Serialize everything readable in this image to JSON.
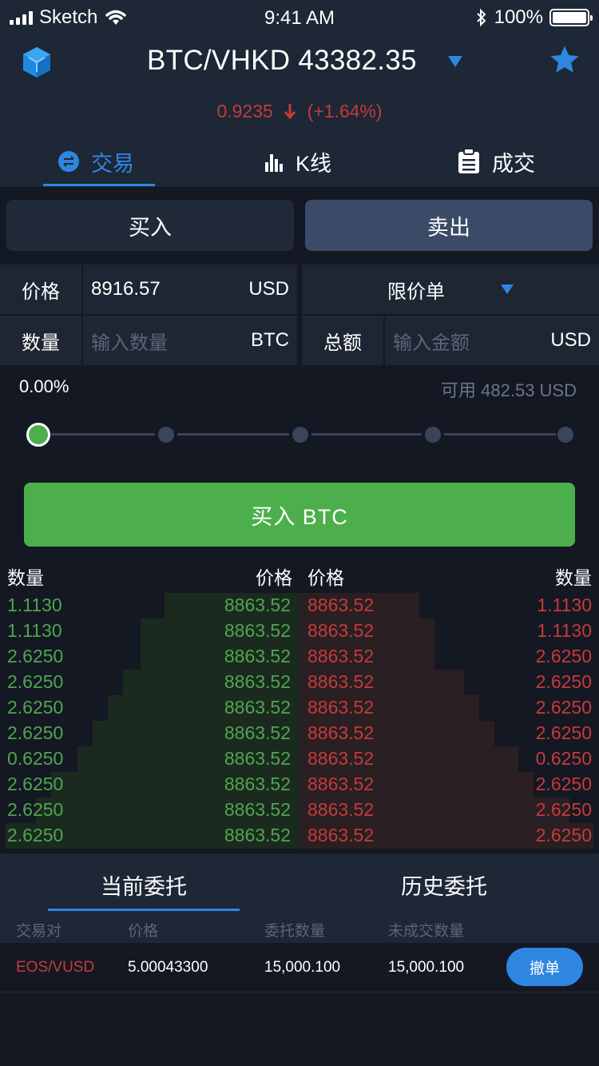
{
  "status": {
    "carrier": "Sketch",
    "time": "9:41 AM",
    "battery": "100%"
  },
  "header": {
    "pair": "BTC/VHKD 43382.35",
    "change_value": "0.9235",
    "change_pct": "(+1.64%)"
  },
  "tabs": [
    {
      "label": "交易",
      "icon": "exchange-icon",
      "active": true
    },
    {
      "label": "K线",
      "icon": "bar-chart-icon",
      "active": false
    },
    {
      "label": "成交",
      "icon": "clipboard-icon",
      "active": false
    }
  ],
  "segment": {
    "buy": "买入",
    "sell": "卖出"
  },
  "form": {
    "price_label": "价格",
    "price_value": "8916.57",
    "price_unit": "USD",
    "order_type": "限价单",
    "qty_label": "数量",
    "qty_placeholder": "输入数量",
    "qty_unit": "BTC",
    "total_label": "总额",
    "total_placeholder": "输入金额",
    "total_unit": "USD",
    "percent": "0.00%",
    "available": "可用 482.53 USD",
    "slider_value": 0
  },
  "buy_button": "买入 BTC",
  "orderbook": {
    "headers": {
      "buy_qty": "数量",
      "buy_price": "价格",
      "sell_price": "价格",
      "sell_qty": "数量"
    },
    "rows": [
      {
        "buy_qty": "1.1130",
        "buy_price": "8863.52",
        "sell_price": "8863.52",
        "sell_qty": "1.1130",
        "buy_depth": 0.45,
        "sell_depth": 0.4
      },
      {
        "buy_qty": "1.1130",
        "buy_price": "8863.52",
        "sell_price": "8863.52",
        "sell_qty": "1.1130",
        "buy_depth": 0.53,
        "sell_depth": 0.45
      },
      {
        "buy_qty": "2.6250",
        "buy_price": "8863.52",
        "sell_price": "8863.52",
        "sell_qty": "2.6250",
        "buy_depth": 0.53,
        "sell_depth": 0.45
      },
      {
        "buy_qty": "2.6250",
        "buy_price": "8863.52",
        "sell_price": "8863.52",
        "sell_qty": "2.6250",
        "buy_depth": 0.59,
        "sell_depth": 0.55
      },
      {
        "buy_qty": "2.6250",
        "buy_price": "8863.52",
        "sell_price": "8863.52",
        "sell_qty": "2.6250",
        "buy_depth": 0.64,
        "sell_depth": 0.6
      },
      {
        "buy_qty": "2.6250",
        "buy_price": "8863.52",
        "sell_price": "8863.52",
        "sell_qty": "2.6250",
        "buy_depth": 0.69,
        "sell_depth": 0.65
      },
      {
        "buy_qty": "0.6250",
        "buy_price": "8863.52",
        "sell_price": "8863.52",
        "sell_qty": "0.6250",
        "buy_depth": 0.74,
        "sell_depth": 0.73
      },
      {
        "buy_qty": "2.6250",
        "buy_price": "8863.52",
        "sell_price": "8863.52",
        "sell_qty": "2.6250",
        "buy_depth": 0.83,
        "sell_depth": 0.78
      },
      {
        "buy_qty": "2.6250",
        "buy_price": "8863.52",
        "sell_price": "8863.52",
        "sell_qty": "2.6250",
        "buy_depth": 0.88,
        "sell_depth": 0.9
      },
      {
        "buy_qty": "2.6250",
        "buy_price": "8863.52",
        "sell_price": "8863.52",
        "sell_qty": "2.6250",
        "buy_depth": 0.98,
        "sell_depth": 0.98
      }
    ]
  },
  "orders": {
    "tabs": [
      "当前委托",
      "历史委托"
    ],
    "headers": [
      "交易对",
      "价格",
      "委托数量",
      "未成交数量"
    ],
    "rows": [
      {
        "pair": "EOS/VUSD",
        "price": "5.00043300",
        "qty": "15,000.100",
        "unfilled": "15,000.100",
        "action": "撤单"
      }
    ]
  },
  "colors": {
    "accent": "#2f86e0",
    "buy": "#4caf4c",
    "sell": "#c63a3a",
    "bg": "#141823",
    "panel": "#1d2736"
  }
}
